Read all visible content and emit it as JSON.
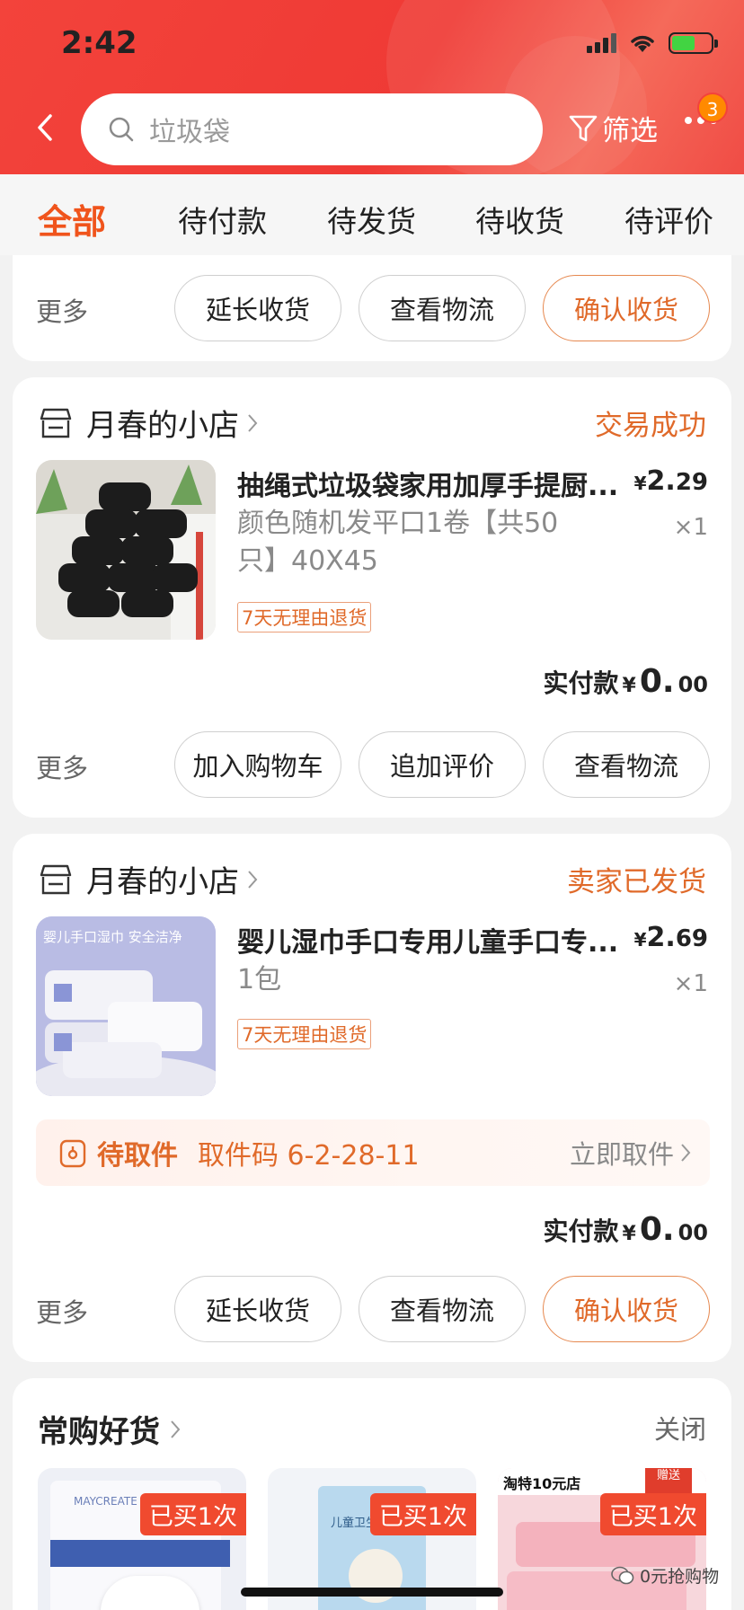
{
  "status_bar": {
    "time": "2:42"
  },
  "header": {
    "search_placeholder": "垃圾袋",
    "filter_label": "筛选",
    "badge_count": "3"
  },
  "tabs": [
    {
      "label": "全部",
      "active": true
    },
    {
      "label": "待付款"
    },
    {
      "label": "待发货"
    },
    {
      "label": "待收货"
    },
    {
      "label": "待评价"
    }
  ],
  "top_actions": {
    "more": "更多",
    "buttons": [
      "延长收货",
      "查看物流",
      "确认收货"
    ]
  },
  "orders": [
    {
      "shop": "月春的小店",
      "status": "交易成功",
      "product_title": "抽绳式垃圾袋家用加厚手提厨...",
      "spec": "颜色随机发平口1卷【共50只】40X45",
      "price_yen": "¥",
      "price_int": "2.",
      "price_dec": "29",
      "qty": "×1",
      "tag": "7天无理由退货",
      "paid_label": "实付款",
      "paid_yen": "¥",
      "paid_int": "0.",
      "paid_dec": "00",
      "more": "更多",
      "buttons": [
        "加入购物车",
        "追加评价",
        "查看物流"
      ]
    },
    {
      "shop": "月春的小店",
      "status": "卖家已发货",
      "product_title": "婴儿湿巾手口专用儿童手口专...",
      "spec": "1包",
      "price_yen": "¥",
      "price_int": "2.",
      "price_dec": "69",
      "qty": "×1",
      "tag": "7天无理由退货",
      "thumb_text": "婴儿手口湿巾 安全洁净",
      "pickup_label": "待取件",
      "pickup_code": "取件码 6-2-28-11",
      "pickup_action": "立即取件",
      "paid_label": "实付款",
      "paid_yen": "¥",
      "paid_int": "0.",
      "paid_dec": "00",
      "more": "更多",
      "buttons": [
        "延长收货",
        "查看物流",
        "确认收货"
      ]
    }
  ],
  "recommend": {
    "title": "常购好货",
    "close": "关闭",
    "items": [
      {
        "badge": "已买1次",
        "brand": "MAYCREATE"
      },
      {
        "badge": "已买1次",
        "brand": "儿童卫生口罩"
      },
      {
        "badge": "已买1次",
        "brand": "淘特10元店",
        "extra": "赠送"
      }
    ]
  },
  "watermark": "0元抢购物",
  "colors": {
    "header_red": "#f3433b",
    "accent_orange": "#e06a2a"
  }
}
